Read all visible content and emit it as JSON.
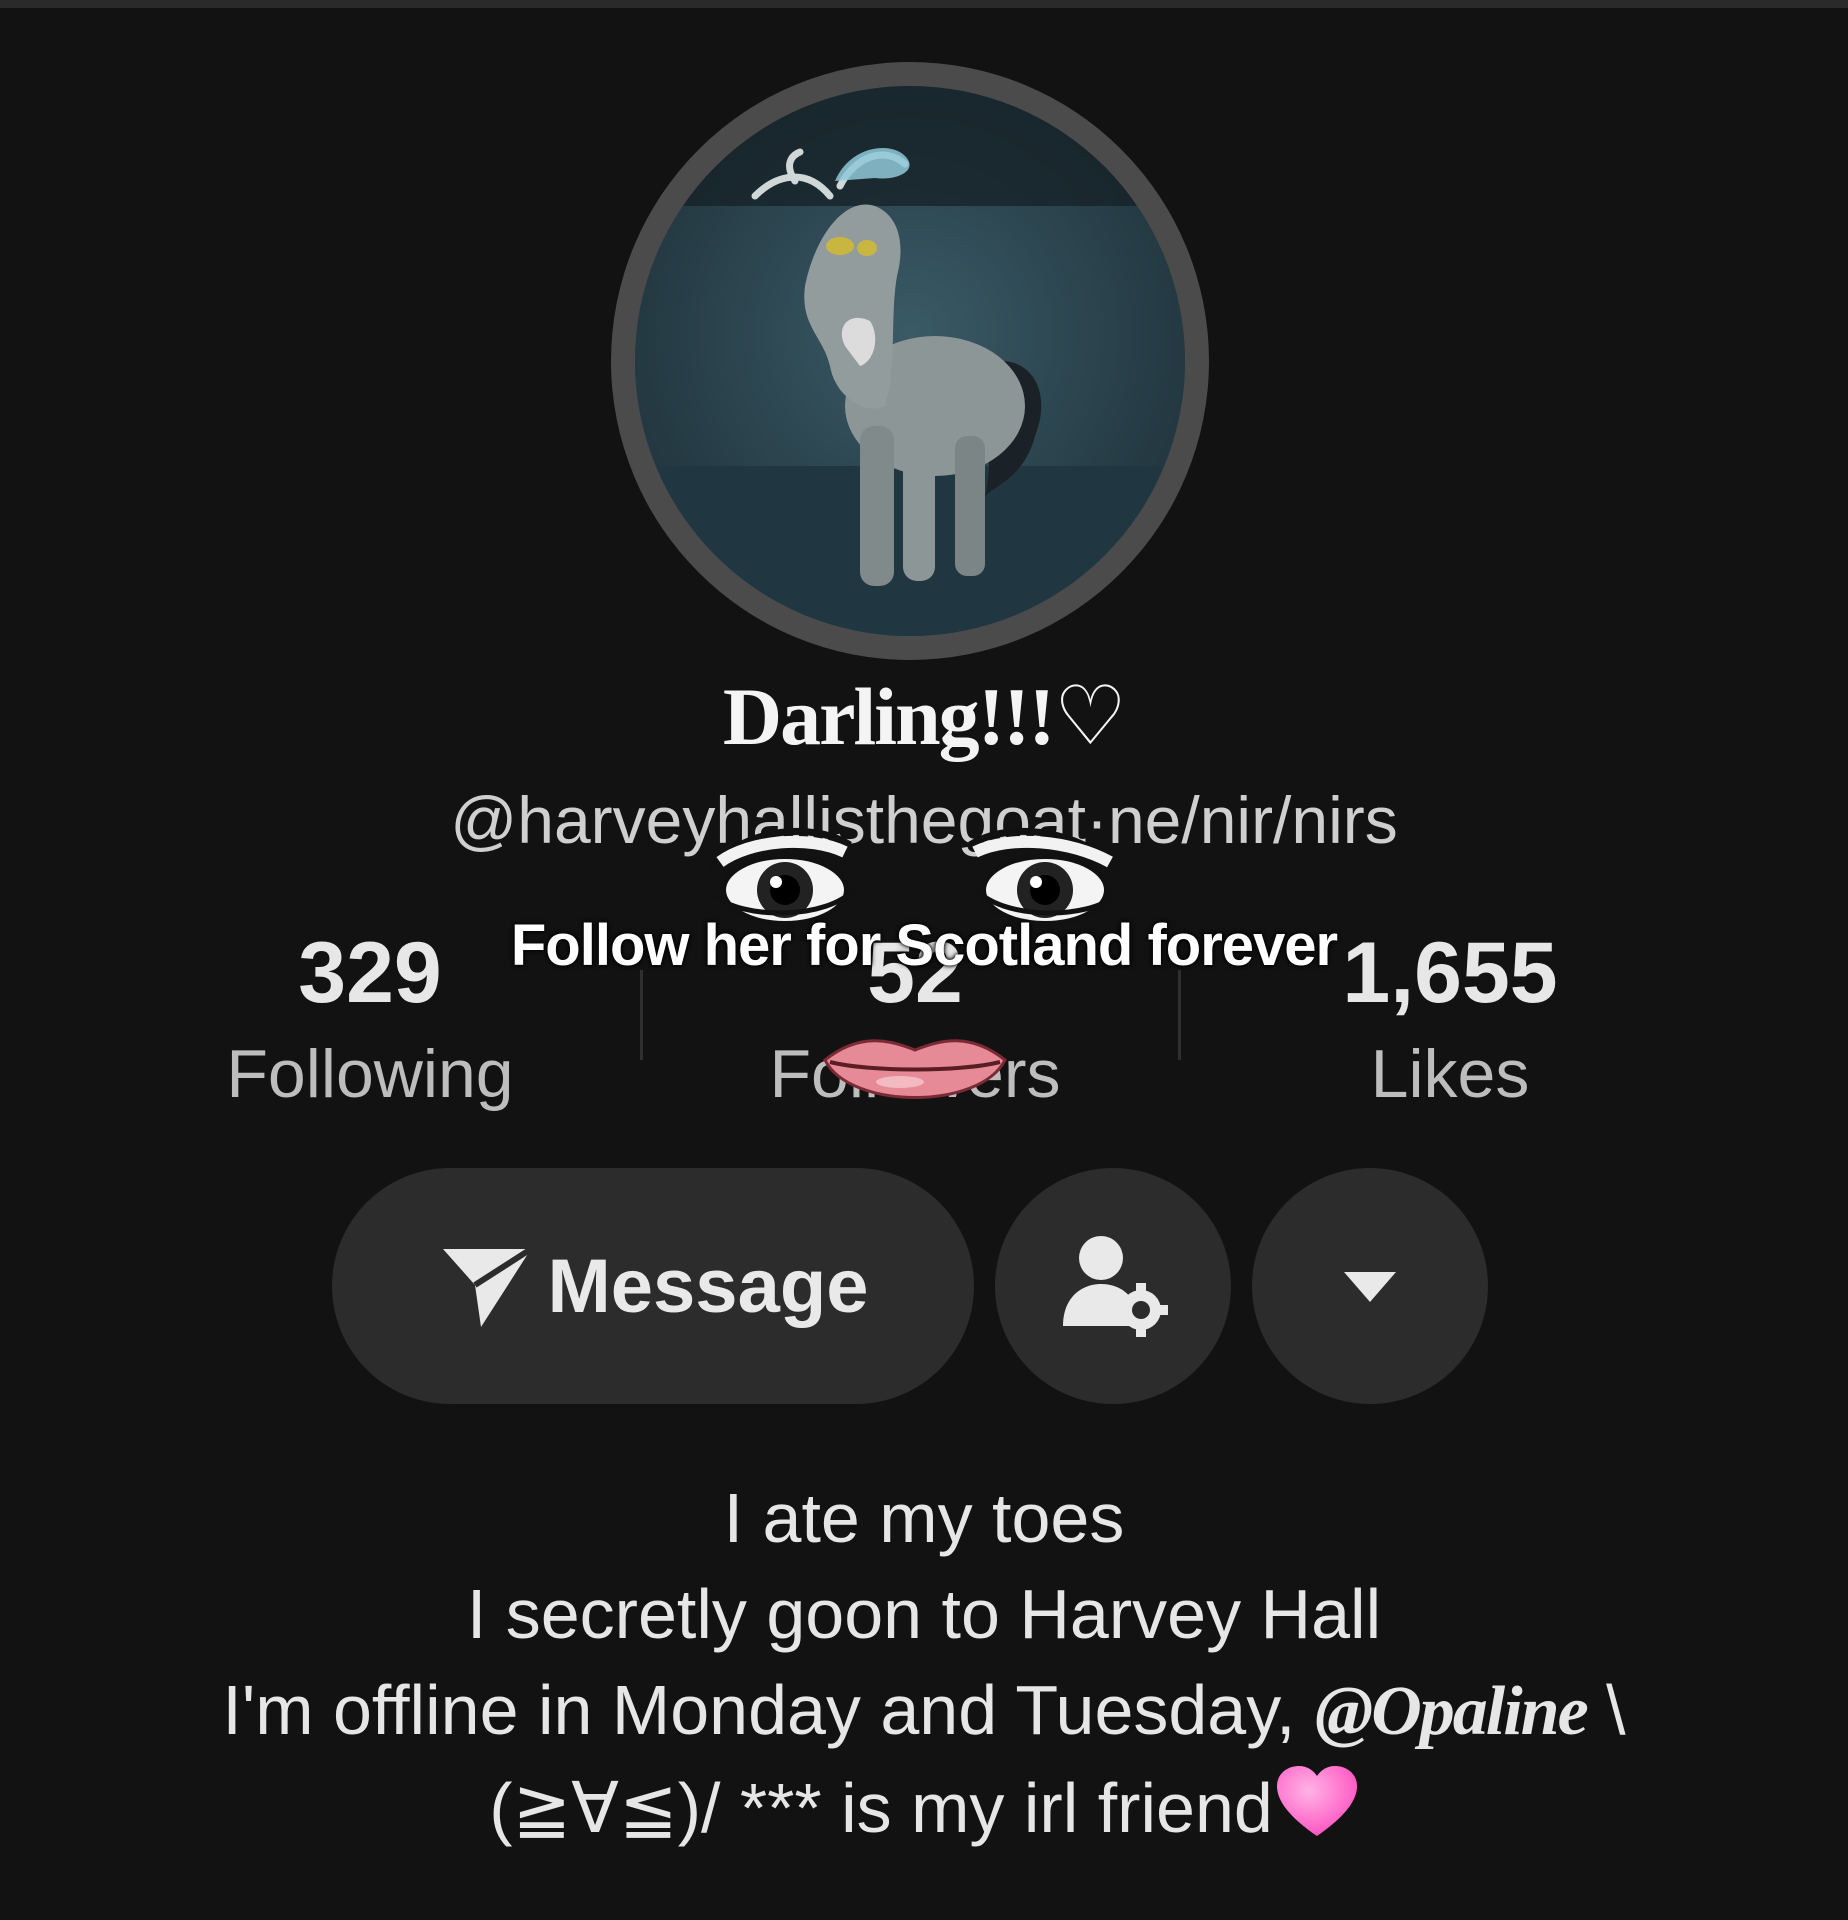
{
  "profile": {
    "display_name": "Darling!!!♡",
    "username": "@harveyhallisthegoat·ne/nir/nirs"
  },
  "stats": {
    "following": {
      "count": "329",
      "label": "Following"
    },
    "followers": {
      "count": "52",
      "label": "Followers"
    },
    "likes": {
      "count": "1,655",
      "label": "Likes"
    }
  },
  "overlay": {
    "caption": "Follow her for Scotland forever"
  },
  "actions": {
    "message_label": "Message"
  },
  "bio": {
    "line1": "I ate my toes",
    "line2": "I secretly goon to Harvey Hall",
    "line3_text": "I'm offline in Monday and Tuesday, ",
    "line3_mention": "@Opaline",
    "line3_tail": " ͏\\",
    "line4_kaomoji": "(≧∀≦)/ ",
    "line4_text": "*** is my irl friend"
  },
  "colors": {
    "background": "#121212",
    "button": "#2c2c2c",
    "avatar_ring": "#4b4b4b",
    "heart": "#ff5fc7"
  },
  "icons": [
    "send-arrow-icon",
    "person-gear-icon",
    "caret-down-icon",
    "pink-heart-emoji"
  ]
}
